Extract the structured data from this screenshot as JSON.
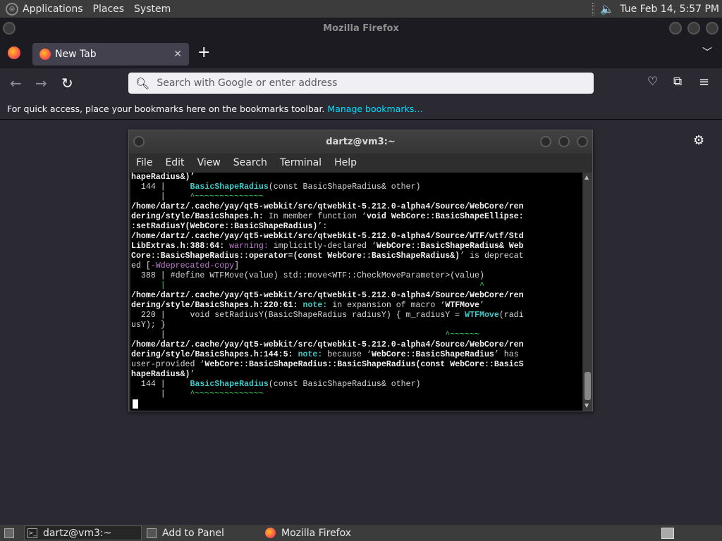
{
  "top_panel": {
    "menus": [
      "Applications",
      "Places",
      "System"
    ],
    "clock": "Tue Feb 14,  5:57 PM"
  },
  "firefox": {
    "window_title": "Mozilla Firefox",
    "tab_label": "New Tab",
    "url_placeholder": "Search with Google or enter address",
    "bookmarks_hint": "For quick access, place your bookmarks here on the bookmarks toolbar.",
    "manage_bookmarks": "Manage bookmarks…"
  },
  "terminal": {
    "title": "dartz@vm3:~",
    "menus": [
      "File",
      "Edit",
      "View",
      "Search",
      "Terminal",
      "Help"
    ],
    "lines": [
      [
        {
          "t": "hapeRadius&)’",
          "s": "b"
        }
      ],
      [
        {
          "t": "  144 |     "
        },
        {
          "t": "BasicShapeRadius",
          "s": "c"
        },
        {
          "t": "(const BasicShapeRadius& other)"
        }
      ],
      [
        {
          "t": "      |     "
        },
        {
          "t": "^~~~~~~~~~~~~~~",
          "s": "caret"
        }
      ],
      [
        {
          "t": "/home/dartz/.cache/yay/qt5-webkit/src/qtwebkit-5.212.0-alpha4/Source/WebCore/ren",
          "s": "b"
        }
      ],
      [
        {
          "t": "dering/style/BasicShapes.h:",
          "s": "b"
        },
        {
          "t": " In member function ‘"
        },
        {
          "t": "void WebCore::BasicShapeEllipse:",
          "s": "b"
        }
      ],
      [
        {
          "t": ":setRadiusY(WebCore::BasicShapeRadius)",
          "s": "b"
        },
        {
          "t": "’:"
        }
      ],
      [
        {
          "t": "/home/dartz/.cache/yay/qt5-webkit/src/qtwebkit-5.212.0-alpha4/Source/WTF/wtf/Std",
          "s": "b"
        }
      ],
      [
        {
          "t": "LibExtras.h:388:64:",
          "s": "b"
        },
        {
          "t": " "
        },
        {
          "t": "warning:",
          "s": "m"
        },
        {
          "t": " implicitly-declared ‘"
        },
        {
          "t": "WebCore::BasicShapeRadius& Web",
          "s": "b"
        }
      ],
      [
        {
          "t": "Core::BasicShapeRadius::operator=(const WebCore::BasicShapeRadius&)",
          "s": "b"
        },
        {
          "t": "’ is deprecat"
        }
      ],
      [
        {
          "t": "ed ["
        },
        {
          "t": "-Wdeprecated-copy",
          "s": "m"
        },
        {
          "t": "]"
        }
      ],
      [
        {
          "t": "  388 | #define WTFMove(value) std::move<WTF::CheckMoveParameter>(value)"
        }
      ],
      [
        {
          "t": "      |                                                                ^",
          "s": "caret"
        }
      ],
      [
        {
          "t": "/home/dartz/.cache/yay/qt5-webkit/src/qtwebkit-5.212.0-alpha4/Source/WebCore/ren",
          "s": "b"
        }
      ],
      [
        {
          "t": "dering/style/BasicShapes.h:220:61:",
          "s": "b"
        },
        {
          "t": " "
        },
        {
          "t": "note:",
          "s": "c"
        },
        {
          "t": " in expansion of macro ‘"
        },
        {
          "t": "WTFMove",
          "s": "b"
        },
        {
          "t": "’"
        }
      ],
      [
        {
          "t": "  220 |     void setRadiusY(BasicShapeRadius radiusY) { m_radiusY = "
        },
        {
          "t": "WTFMove",
          "s": "c"
        },
        {
          "t": "(radi"
        }
      ],
      [
        {
          "t": "usY); }"
        }
      ],
      [
        {
          "t": "      |                                                         "
        },
        {
          "t": "^~~~~~~",
          "s": "caret"
        }
      ],
      [
        {
          "t": "/home/dartz/.cache/yay/qt5-webkit/src/qtwebkit-5.212.0-alpha4/Source/WebCore/ren",
          "s": "b"
        }
      ],
      [
        {
          "t": "dering/style/BasicShapes.h:144:5:",
          "s": "b"
        },
        {
          "t": " "
        },
        {
          "t": "note:",
          "s": "c"
        },
        {
          "t": " because ‘"
        },
        {
          "t": "WebCore::BasicShapeRadius",
          "s": "b"
        },
        {
          "t": "’ has"
        }
      ],
      [
        {
          "t": "user-provided ‘"
        },
        {
          "t": "WebCore::BasicShapeRadius::BasicShapeRadius(const WebCore::BasicS",
          "s": "b"
        }
      ],
      [
        {
          "t": "hapeRadius&)",
          "s": "b"
        },
        {
          "t": "’"
        }
      ],
      [
        {
          "t": "  144 |     "
        },
        {
          "t": "BasicShapeRadius",
          "s": "c"
        },
        {
          "t": "(const BasicShapeRadius& other)"
        }
      ],
      [
        {
          "t": "      |     "
        },
        {
          "t": "^~~~~~~~~~~~~~~",
          "s": "caret"
        }
      ]
    ]
  },
  "taskbar": {
    "items": [
      "dartz@vm3:~",
      "Add to Panel",
      "Mozilla Firefox"
    ]
  },
  "icons": {
    "firefox": "firefox-icon",
    "search": "search-icon",
    "settings": "gear-icon",
    "volume": "volume-icon",
    "terminal": "terminal-icon"
  }
}
